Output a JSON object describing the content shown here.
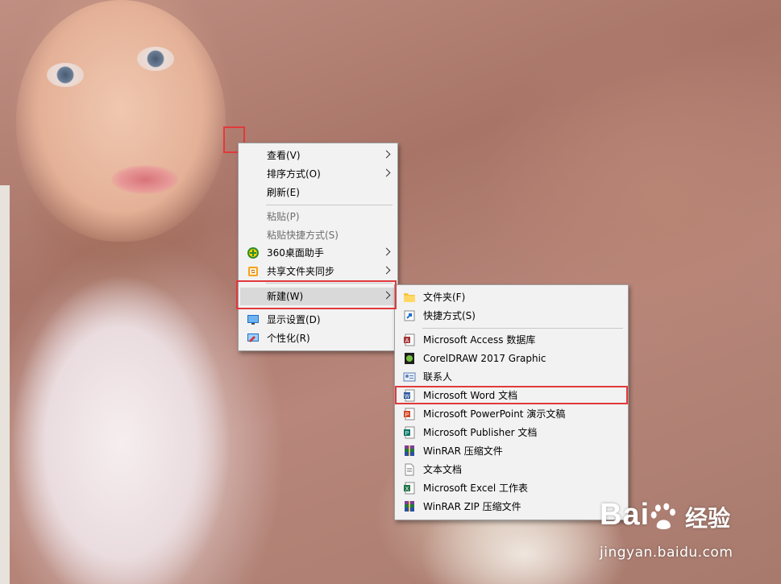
{
  "context_menu": {
    "items": [
      {
        "label": "查看(V)"
      },
      {
        "label": "排序方式(O)"
      },
      {
        "label": "刷新(E)"
      },
      {
        "label": "粘贴(P)"
      },
      {
        "label": "粘贴快捷方式(S)"
      },
      {
        "label": "360桌面助手"
      },
      {
        "label": "共享文件夹同步"
      },
      {
        "label": "新建(W)"
      },
      {
        "label": "显示设置(D)"
      },
      {
        "label": "个性化(R)"
      }
    ]
  },
  "new_submenu": {
    "items": [
      {
        "label": "文件夹(F)"
      },
      {
        "label": "快捷方式(S)"
      },
      {
        "label": "Microsoft Access 数据库"
      },
      {
        "label": "CorelDRAW 2017 Graphic"
      },
      {
        "label": "联系人"
      },
      {
        "label": "Microsoft Word 文档"
      },
      {
        "label": "Microsoft PowerPoint 演示文稿"
      },
      {
        "label": "Microsoft Publisher 文档"
      },
      {
        "label": "WinRAR 压缩文件"
      },
      {
        "label": "文本文档"
      },
      {
        "label": "Microsoft Excel 工作表"
      },
      {
        "label": "WinRAR ZIP 压缩文件"
      }
    ]
  },
  "watermark": {
    "logo": "Bai",
    "logo2": "经验",
    "url": "jingyan.baidu.com"
  },
  "colors": {
    "highlight_box": "#e2393c",
    "menu_bg": "#f2f2f2",
    "hover_bg": "#d9d9d9"
  }
}
